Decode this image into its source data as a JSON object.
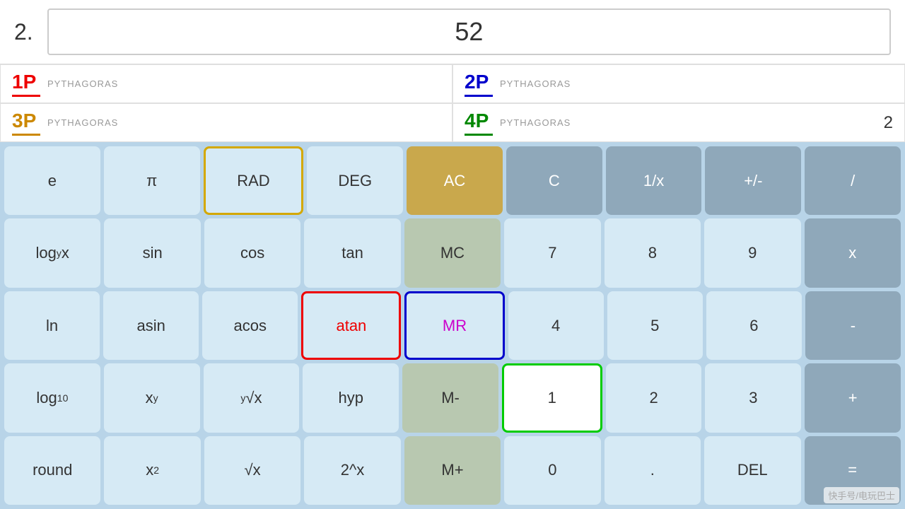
{
  "header": {
    "question_number": "2.",
    "answer": "52"
  },
  "panels": [
    {
      "id": "1P",
      "color": "red",
      "underline": "underline-red",
      "label": "PYTHAGORAS",
      "value": ""
    },
    {
      "id": "2P",
      "color": "blue",
      "underline": "underline-blue",
      "label": "PYTHAGORAS",
      "value": ""
    },
    {
      "id": "3P",
      "color": "orange",
      "underline": "underline-orange",
      "label": "PYTHAGORAS",
      "value": ""
    },
    {
      "id": "4P",
      "color": "green",
      "underline": "underline-green",
      "label": "PYTHAGORAS",
      "value": "2"
    }
  ],
  "calculator": {
    "rows": [
      [
        {
          "label": "e",
          "style": "btn-light",
          "name": "e-button"
        },
        {
          "label": "π",
          "style": "btn-light",
          "name": "pi-button"
        },
        {
          "label": "RAD",
          "style": "btn-rad",
          "name": "rad-button"
        },
        {
          "label": "DEG",
          "style": "btn-light",
          "name": "deg-button"
        },
        {
          "label": "AC",
          "style": "btn-gold",
          "name": "ac-button"
        },
        {
          "label": "C",
          "style": "btn-gray",
          "name": "c-button"
        },
        {
          "label": "1/x",
          "style": "btn-gray",
          "name": "reciprocal-button"
        },
        {
          "label": "+/-",
          "style": "btn-gray",
          "name": "negate-button"
        },
        {
          "label": "/",
          "style": "btn-gray",
          "name": "divide-button"
        }
      ],
      [
        {
          "label": "logᵧx",
          "style": "btn-light",
          "name": "logy-button"
        },
        {
          "label": "sin",
          "style": "btn-light",
          "name": "sin-button"
        },
        {
          "label": "cos",
          "style": "btn-light",
          "name": "cos-button"
        },
        {
          "label": "tan",
          "style": "btn-light",
          "name": "tan-button"
        },
        {
          "label": "MC",
          "style": "btn-mc",
          "name": "mc-button"
        },
        {
          "label": "7",
          "style": "btn-light",
          "name": "seven-button"
        },
        {
          "label": "8",
          "style": "btn-light",
          "name": "eight-button"
        },
        {
          "label": "9",
          "style": "btn-light",
          "name": "nine-button"
        },
        {
          "label": "x",
          "style": "btn-gray",
          "name": "multiply-button"
        }
      ],
      [
        {
          "label": "ln",
          "style": "btn-light",
          "name": "ln-button"
        },
        {
          "label": "asin",
          "style": "btn-light",
          "name": "asin-button"
        },
        {
          "label": "acos",
          "style": "btn-light",
          "name": "acos-button"
        },
        {
          "label": "atan",
          "style": "btn-atan",
          "name": "atan-button"
        },
        {
          "label": "MR",
          "style": "btn-mr",
          "name": "mr-button"
        },
        {
          "label": "4",
          "style": "btn-light",
          "name": "four-button"
        },
        {
          "label": "5",
          "style": "btn-light",
          "name": "five-button"
        },
        {
          "label": "6",
          "style": "btn-light",
          "name": "six-button"
        },
        {
          "label": "-",
          "style": "btn-gray",
          "name": "minus-button"
        }
      ],
      [
        {
          "label": "log₁₀",
          "style": "btn-light",
          "name": "log10-button"
        },
        {
          "label": "xʸ",
          "style": "btn-light",
          "name": "xpowy-button"
        },
        {
          "label": "ʸ√x",
          "style": "btn-light",
          "name": "yroot-button"
        },
        {
          "label": "hyp",
          "style": "btn-light",
          "name": "hyp-button"
        },
        {
          "label": "M-",
          "style": "btn-mminus",
          "name": "mminus-button"
        },
        {
          "label": "1",
          "style": "btn-one",
          "name": "one-button"
        },
        {
          "label": "2",
          "style": "btn-light",
          "name": "two-button"
        },
        {
          "label": "3",
          "style": "btn-light",
          "name": "three-button"
        },
        {
          "label": "+",
          "style": "btn-gray",
          "name": "plus-button"
        }
      ],
      [
        {
          "label": "round",
          "style": "btn-light",
          "name": "round-button"
        },
        {
          "label": "x²",
          "style": "btn-light",
          "name": "square-button"
        },
        {
          "label": "√x",
          "style": "btn-light",
          "name": "sqrt-button"
        },
        {
          "label": "2^x",
          "style": "btn-light",
          "name": "twopowx-button"
        },
        {
          "label": "M+",
          "style": "btn-mplus",
          "name": "mplus-button"
        },
        {
          "label": "0",
          "style": "btn-light",
          "name": "zero-button"
        },
        {
          "label": ".",
          "style": "btn-light",
          "name": "decimal-button"
        },
        {
          "label": "DEL",
          "style": "btn-light",
          "name": "del-button"
        },
        {
          "label": "=",
          "style": "btn-gray",
          "name": "equals-button"
        }
      ]
    ]
  },
  "watermark": "快手号/电玩巴士"
}
